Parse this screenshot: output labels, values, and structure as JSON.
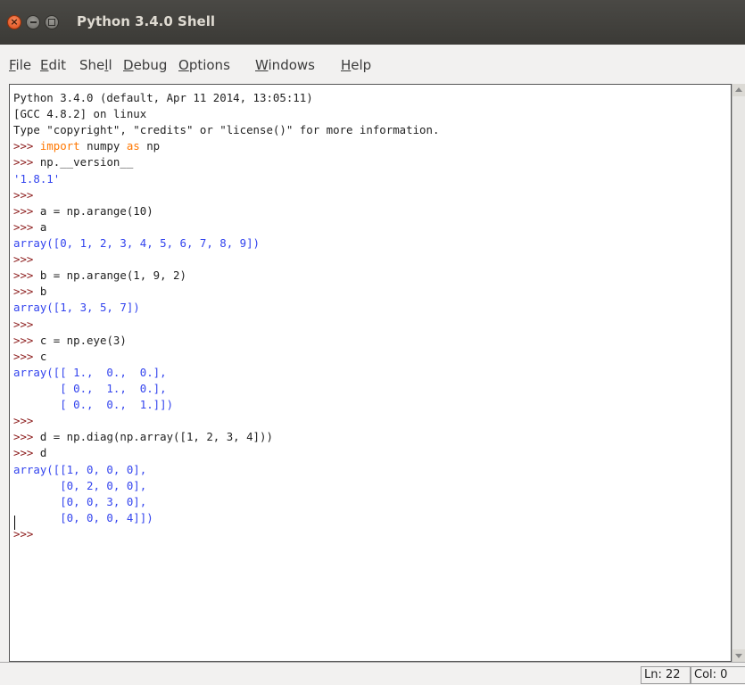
{
  "window": {
    "title": "Python 3.4.0 Shell"
  },
  "menu": [
    {
      "pre": "",
      "u": "F",
      "post": "ile"
    },
    {
      "pre": "",
      "u": "E",
      "post": "dit"
    },
    {
      "pre": "She",
      "u": "l",
      "post": "l"
    },
    {
      "pre": "",
      "u": "D",
      "post": "ebug"
    },
    {
      "pre": "",
      "u": "O",
      "post": "ptions"
    },
    {
      "pre": "",
      "u": "W",
      "post": "indows"
    },
    {
      "pre": "",
      "u": "H",
      "post": "elp"
    }
  ],
  "shell": {
    "lines": [
      [
        {
          "t": "Python 3.4.0 (default, Apr 11 2014, 13:05:11)",
          "c": "info"
        }
      ],
      [
        {
          "t": "[GCC 4.8.2] on linux",
          "c": "info"
        }
      ],
      [
        {
          "t": "Type \"copyright\", \"credits\" or \"license()\" for more information.",
          "c": "info"
        }
      ],
      [
        {
          "t": ">>> ",
          "c": "prompt"
        },
        {
          "t": "import",
          "c": "kw"
        },
        {
          "t": " numpy ",
          "c": "info"
        },
        {
          "t": "as",
          "c": "kw"
        },
        {
          "t": " np",
          "c": "info"
        }
      ],
      [
        {
          "t": ">>> ",
          "c": "prompt"
        },
        {
          "t": "np.__version__",
          "c": "info"
        }
      ],
      [
        {
          "t": "'1.8.1'",
          "c": "out"
        }
      ],
      [
        {
          "t": ">>> ",
          "c": "prompt"
        }
      ],
      [
        {
          "t": ">>> ",
          "c": "prompt"
        },
        {
          "t": "a = np.arange(10)",
          "c": "info"
        }
      ],
      [
        {
          "t": ">>> ",
          "c": "prompt"
        },
        {
          "t": "a",
          "c": "info"
        }
      ],
      [
        {
          "t": "array([0, 1, 2, 3, 4, 5, 6, 7, 8, 9])",
          "c": "out"
        }
      ],
      [
        {
          "t": ">>> ",
          "c": "prompt"
        }
      ],
      [
        {
          "t": ">>> ",
          "c": "prompt"
        },
        {
          "t": "b = np.arange(1, 9, 2)",
          "c": "info"
        }
      ],
      [
        {
          "t": ">>> ",
          "c": "prompt"
        },
        {
          "t": "b",
          "c": "info"
        }
      ],
      [
        {
          "t": "array([1, 3, 5, 7])",
          "c": "out"
        }
      ],
      [
        {
          "t": ">>> ",
          "c": "prompt"
        }
      ],
      [
        {
          "t": ">>> ",
          "c": "prompt"
        },
        {
          "t": "c = np.eye(3)",
          "c": "info"
        }
      ],
      [
        {
          "t": ">>> ",
          "c": "prompt"
        },
        {
          "t": "c",
          "c": "info"
        }
      ],
      [
        {
          "t": "array([[ 1.,  0.,  0.],",
          "c": "out"
        }
      ],
      [
        {
          "t": "       [ 0.,  1.,  0.],",
          "c": "out"
        }
      ],
      [
        {
          "t": "       [ 0.,  0.,  1.]])",
          "c": "out"
        }
      ],
      [
        {
          "t": ">>> ",
          "c": "prompt"
        }
      ],
      [
        {
          "t": ">>> ",
          "c": "prompt"
        },
        {
          "t": "d = np.diag(np.array([1, 2, 3, 4]))",
          "c": "info"
        }
      ],
      [
        {
          "t": ">>> ",
          "c": "prompt"
        },
        {
          "t": "d",
          "c": "info"
        }
      ],
      [
        {
          "t": "array([[1, 0, 0, 0],",
          "c": "out"
        }
      ],
      [
        {
          "t": "       [0, 2, 0, 0],",
          "c": "out"
        }
      ],
      [
        {
          "t": "       [0, 0, 3, 0],",
          "c": "out"
        }
      ],
      [
        {
          "t": "       [0, 0, 0, 4]])",
          "c": "out"
        }
      ],
      [
        {
          "t": ">>> ",
          "c": "prompt"
        }
      ]
    ]
  },
  "status": {
    "ln": "Ln: 22",
    "col": "Col: 0"
  },
  "colors": {
    "prompt": "#8b1a1a",
    "keyword": "#ff7700",
    "output": "#3344ee",
    "close_button": "#df4a16"
  },
  "icons": [
    "close-icon",
    "minimize-icon",
    "maximize-icon",
    "scroll-up-icon",
    "scroll-down-icon"
  ]
}
